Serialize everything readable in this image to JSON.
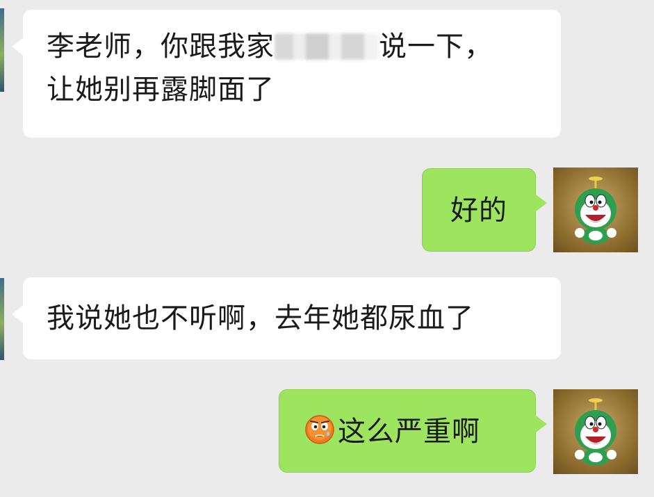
{
  "messages": [
    {
      "direction": "incoming",
      "text_before_redaction": "李老师，你跟我家",
      "text_after_redaction": "说一下，",
      "line2": "让她别再露脚面了"
    },
    {
      "direction": "outgoing",
      "text": "好的"
    },
    {
      "direction": "incoming",
      "text": "我说她也不听啊，去年她都尿血了"
    },
    {
      "direction": "outgoing",
      "emoji": "worried-face-emoji",
      "text": "这么严重啊"
    }
  ],
  "colors": {
    "background": "#ebebeb",
    "incoming_bubble": "#ffffff",
    "outgoing_bubble": "#9ee55f"
  },
  "icons": {
    "own_avatar": "doraemon-avatar-icon",
    "contact_avatar": "contact-avatar-icon"
  }
}
